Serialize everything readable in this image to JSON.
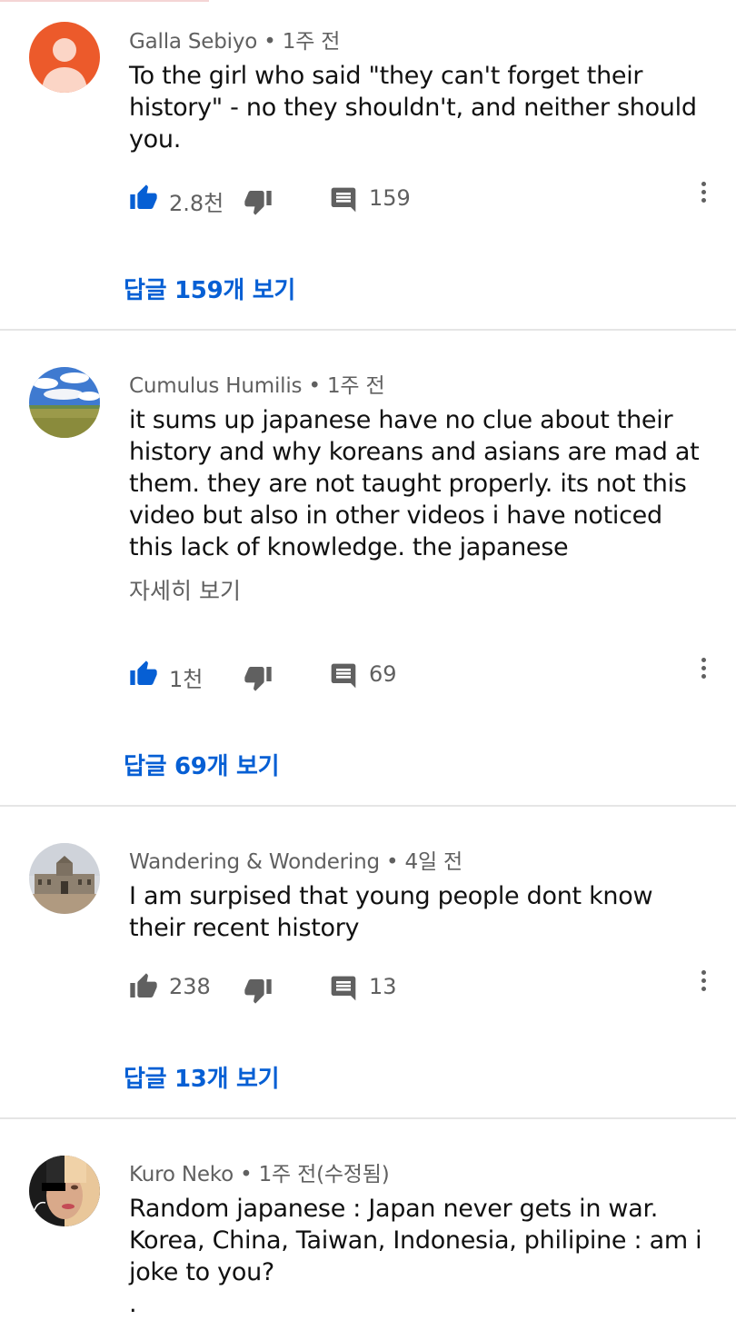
{
  "comments": [
    {
      "author": "Galla Sebiyo",
      "time": "1주 전",
      "text": "To the girl who said \"they can't forget their history\" - no they shouldn't, and neither should you.",
      "likes": "2.8천",
      "reply_count": "159",
      "replies_label": "답글 159개 보기",
      "liked": true
    },
    {
      "author": "Cumulus Humilis",
      "time": "1주 전",
      "text": "it sums up japanese have no clue about their history and why koreans and asians are mad at them. they are not taught properly. its not this video but also in other videos i have noticed this lack of knowledge. the japanese",
      "more_label": "자세히 보기",
      "likes": "1천",
      "reply_count": "69",
      "replies_label": "답글 69개 보기",
      "liked": true
    },
    {
      "author": "Wandering & Wondering",
      "time": "4일 전",
      "text": "I am surpised that young people dont know their recent history",
      "likes": "238",
      "reply_count": "13",
      "replies_label": "답글 13개 보기",
      "liked": false
    },
    {
      "author": "Kuro Neko",
      "time": "1주 전(수정됨)",
      "text": "Random japanese : Japan never gets in war. Korea, China, Taiwan, Indonesia, philipine : am i joke to you?",
      "text_tail": "."
    }
  ],
  "separator": "•",
  "colors": {
    "link": "#065fd4",
    "liked": "#065fd4",
    "meta": "#606060",
    "avatar_default": "#ec5a2b"
  },
  "icons": [
    "like-icon",
    "dislike-icon",
    "reply-icon",
    "more-vert-icon"
  ]
}
